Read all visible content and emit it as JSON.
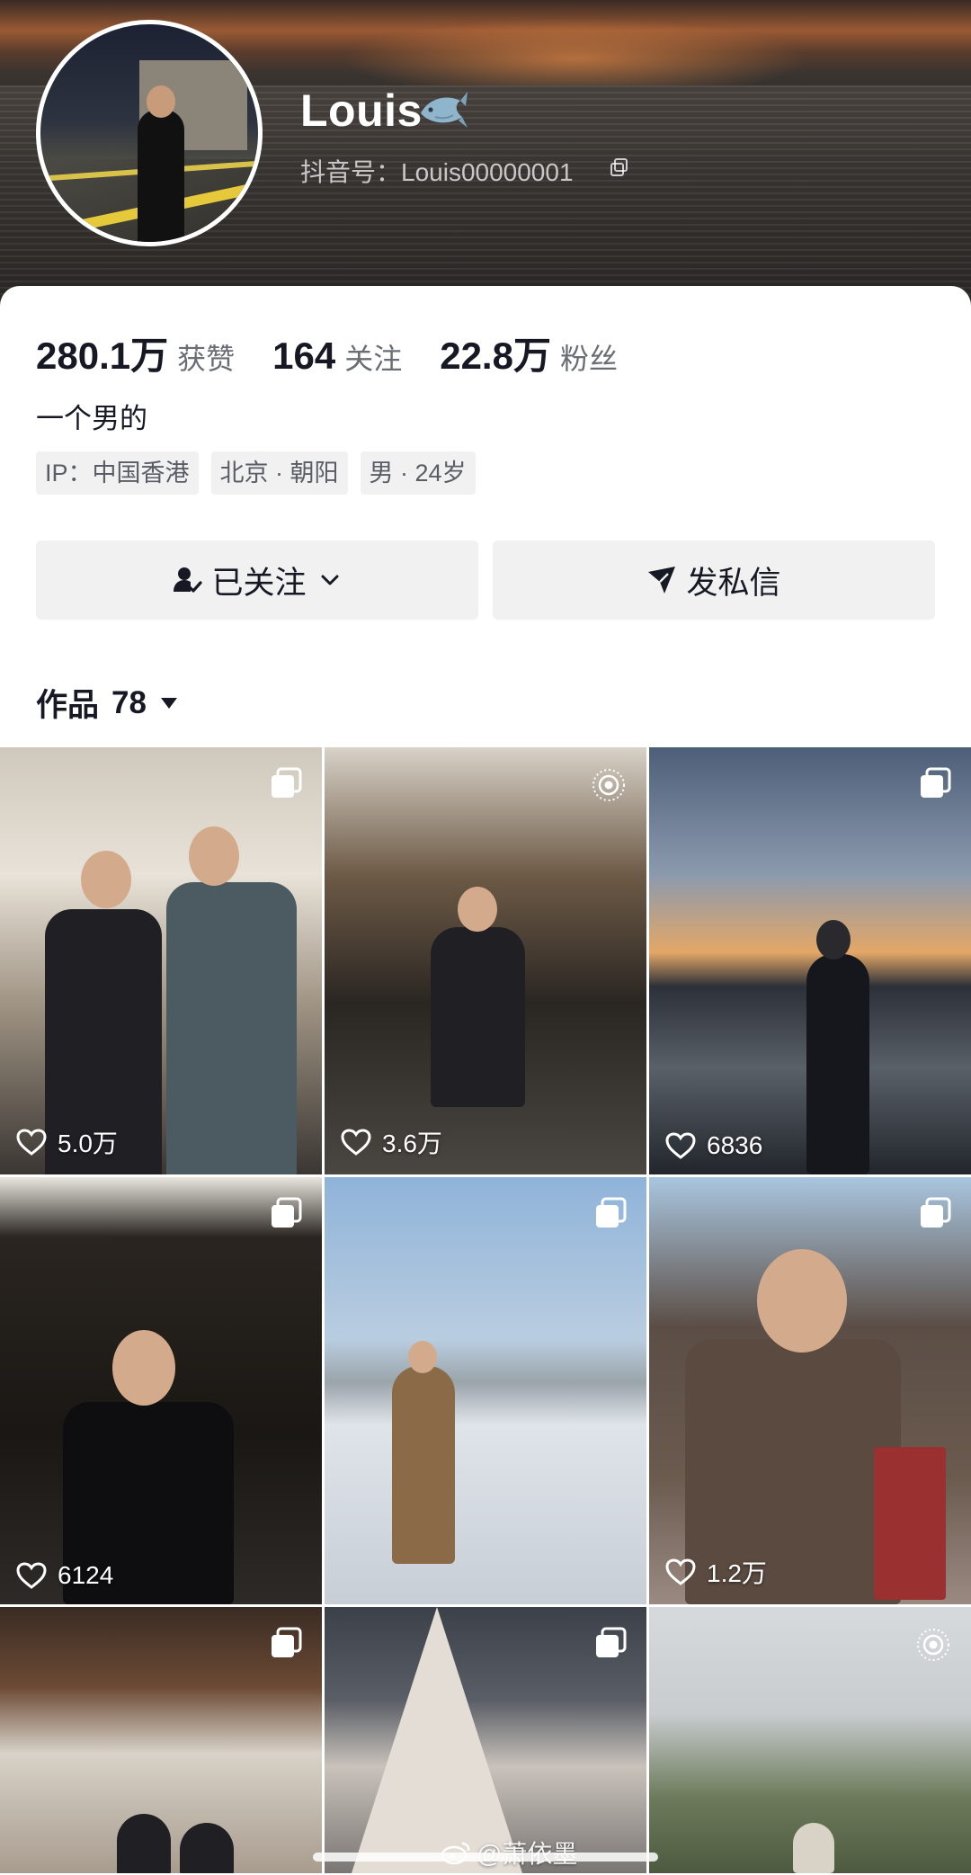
{
  "profile": {
    "name": "Louis",
    "account_label": "抖音号：Louis00000001",
    "bio": "一个男的"
  },
  "stats": [
    {
      "value": "280.1万",
      "label": "获赞"
    },
    {
      "value": "164",
      "label": "关注"
    },
    {
      "value": "22.8万",
      "label": "粉丝"
    }
  ],
  "tags": [
    "IP：中国香港",
    "北京 · 朝阳",
    "男 · 24岁"
  ],
  "actions": {
    "follow_label": "已关注",
    "message_label": "发私信"
  },
  "works": {
    "label": "作品",
    "count": "78"
  },
  "posts": [
    {
      "likes": "5.0万",
      "badge": "gallery-icon"
    },
    {
      "likes": "3.6万",
      "badge": "live-photo-icon"
    },
    {
      "likes": "6836",
      "badge": "gallery-icon"
    },
    {
      "likes": "6124",
      "badge": "gallery-icon"
    },
    {
      "likes": "",
      "badge": "gallery-icon"
    },
    {
      "likes": "1.2万",
      "badge": "gallery-icon"
    },
    {
      "likes": "",
      "badge": "gallery-icon"
    },
    {
      "likes": "",
      "badge": "gallery-icon"
    },
    {
      "likes": "",
      "badge": "live-photo-icon"
    }
  ],
  "watermark": "@萧依墨",
  "colors": {
    "text_primary": "#161823",
    "text_secondary": "#6b6d75",
    "button_bg": "#f1f1f2"
  }
}
